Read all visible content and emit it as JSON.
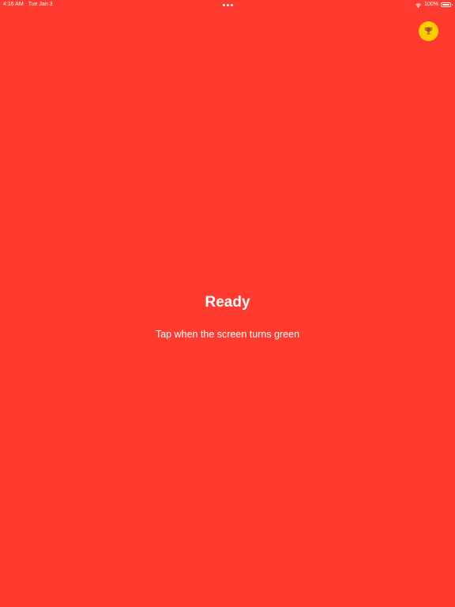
{
  "status_bar": {
    "time": "4:16 AM",
    "date": "Tue Jan 3",
    "battery": "100%",
    "battery_level": 1.0
  },
  "trophy_button": {
    "icon": "trophy-icon",
    "color": "#FFCC00"
  },
  "main": {
    "title": "Ready",
    "subtitle": "Tap when the screen turns green"
  },
  "colors": {
    "background": "#FF3B30",
    "text": "#FFFFFF"
  }
}
